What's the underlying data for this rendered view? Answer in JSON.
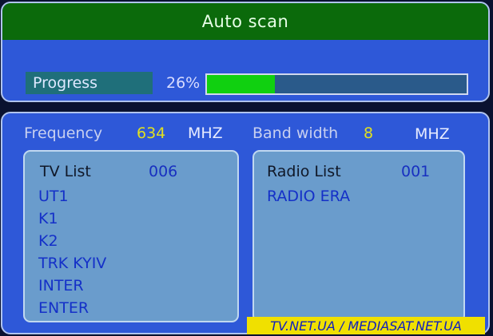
{
  "title": "Auto scan",
  "progress": {
    "label": "Progress",
    "percent_text": "26%",
    "fraction": 0.26
  },
  "info": {
    "frequency_label": "Frequency",
    "frequency_value": "634",
    "frequency_unit": "MHZ",
    "bandwidth_label": "Band width",
    "bandwidth_value": "8",
    "bandwidth_unit": "MHZ"
  },
  "tv_list": {
    "header": "TV List",
    "count": "006",
    "items": [
      "UT1",
      "K1",
      "K2",
      "TRK KYIV",
      "INTER",
      "ENTER"
    ]
  },
  "radio_list": {
    "header": "Radio List",
    "count": "001",
    "items": [
      "RADIO ERA"
    ]
  },
  "watermark": "TV.NET.UA / MEDIASAT.NET.UA",
  "colors": {
    "title_bar": "#0b6a0b",
    "panel": "#2e58d8",
    "progress_fill": "#10d010",
    "list_bg": "#6a9ccc"
  }
}
